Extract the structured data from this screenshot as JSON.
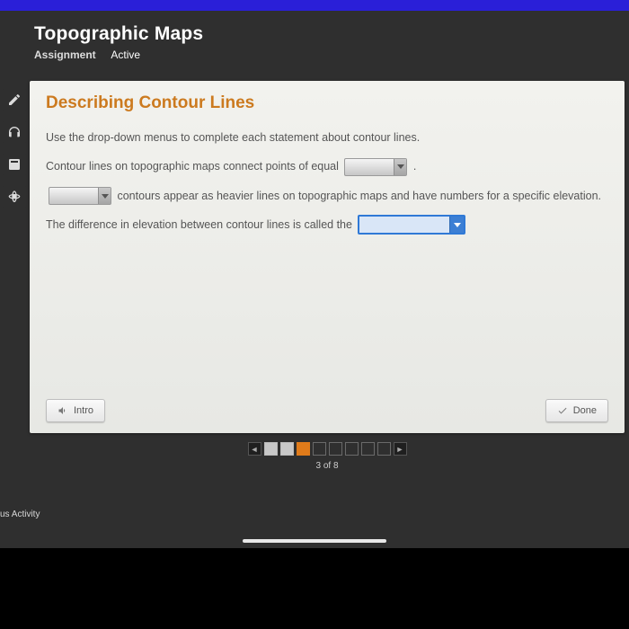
{
  "header": {
    "title": "Topographic Maps",
    "subtitle_label": "Assignment",
    "status": "Active"
  },
  "panel": {
    "heading": "Describing Contour Lines",
    "instruction": "Use the drop-down menus to complete each statement about contour lines.",
    "line1_pre": "Contour lines on topographic maps connect points of equal ",
    "line1_post": ".",
    "line2_mid": " contours appear as heavier lines on topographic maps and have numbers for a specific elevation.",
    "line3_pre": "The difference in elevation between contour lines is called the ",
    "intro_label": "Intro",
    "done_label": "Done"
  },
  "pager": {
    "current": 3,
    "total": 8,
    "label": "3 of 8"
  },
  "footer_text": "us Activity"
}
